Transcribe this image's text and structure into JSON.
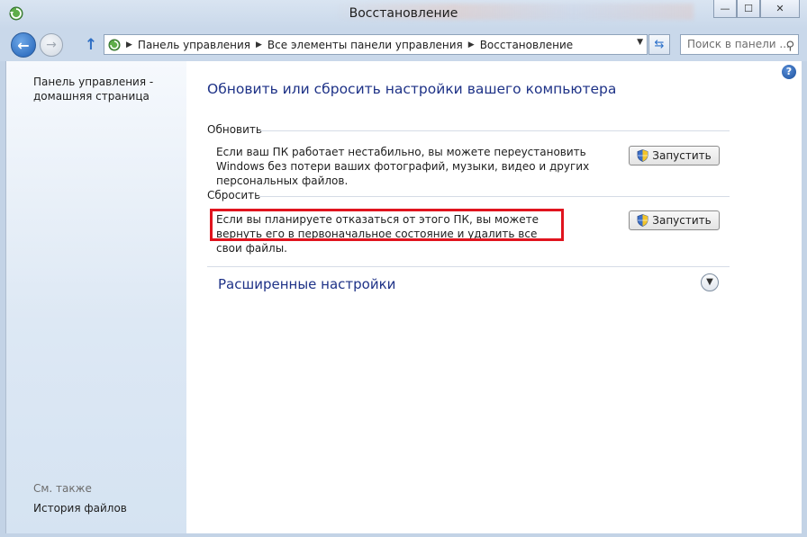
{
  "window": {
    "title": "Восстановление",
    "controls": {
      "minimize": "—",
      "maximize": "☐",
      "close": "✕"
    }
  },
  "navigation": {
    "back_icon": "back-arrow-icon",
    "forward_icon": "forward-arrow-icon",
    "up_icon": "up-arrow-icon",
    "breadcrumbs": [
      "Панель управления",
      "Все элементы панели управления",
      "Восстановление"
    ],
    "search_placeholder": "Поиск в панели ..."
  },
  "sidebar": {
    "home_link": "Панель управления - домашняя страница",
    "see_also": "См. также",
    "links": [
      "История файлов"
    ]
  },
  "main": {
    "title": "Обновить или сбросить настройки вашего компьютера",
    "refresh": {
      "heading": "Обновить",
      "description": "Если ваш ПК работает нестабильно, вы можете переустановить Windows без потери ваших фотографий, музыки, видео и других персональных файлов.",
      "button": "Запустить"
    },
    "reset": {
      "heading": "Сбросить",
      "description": "Если вы планируете отказаться от этого ПК, вы можете вернуть его в первоначальное состояние и удалить все свои файлы.",
      "button": "Запустить"
    },
    "advanced": {
      "label": "Расширенные настройки"
    }
  },
  "colors": {
    "link_blue": "#1e3287",
    "highlight_red": "#e0141e",
    "titlebar": "#c9d8ea"
  }
}
